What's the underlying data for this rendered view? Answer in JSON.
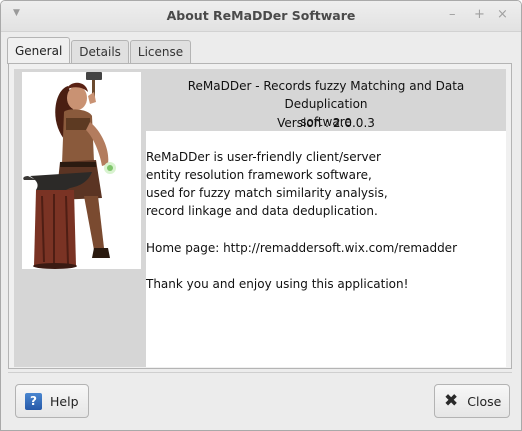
{
  "window": {
    "title": "About ReMaDDer Software",
    "menu_glyph": "▼",
    "minimize_glyph": "–",
    "maximize_glyph": "+",
    "close_glyph": "×"
  },
  "tabs": [
    {
      "label": "General",
      "active": true
    },
    {
      "label": "Details",
      "active": false
    },
    {
      "label": "License",
      "active": false
    }
  ],
  "general": {
    "app_title_line1": "ReMaDDer - Records fuzzy Matching and Data Deduplication",
    "app_title_line2": "software",
    "version": "Version : 2.0.0.3",
    "description": [
      "ReMaDDer is user-friendly client/server",
      "entity resolution framework software,",
      "used for  fuzzy match similarity analysis,",
      "record linkage and data deduplication."
    ],
    "homepage": "Home page: http://remaddersoft.wix.com/remadder",
    "thanks": "Thank you and enjoy using this application!"
  },
  "buttons": {
    "help_label": "Help",
    "help_icon_glyph": "?",
    "close_label": "Close",
    "close_icon_glyph": "✖"
  },
  "icons": {
    "help": "help-icon",
    "close": "close-icon",
    "illustration": "blacksmith-illustration"
  },
  "colors": {
    "window_bg": "#ececec",
    "content_white": "#ffffff",
    "header_gray": "#d6d6d6",
    "help_blue": "#2f6bbd"
  }
}
